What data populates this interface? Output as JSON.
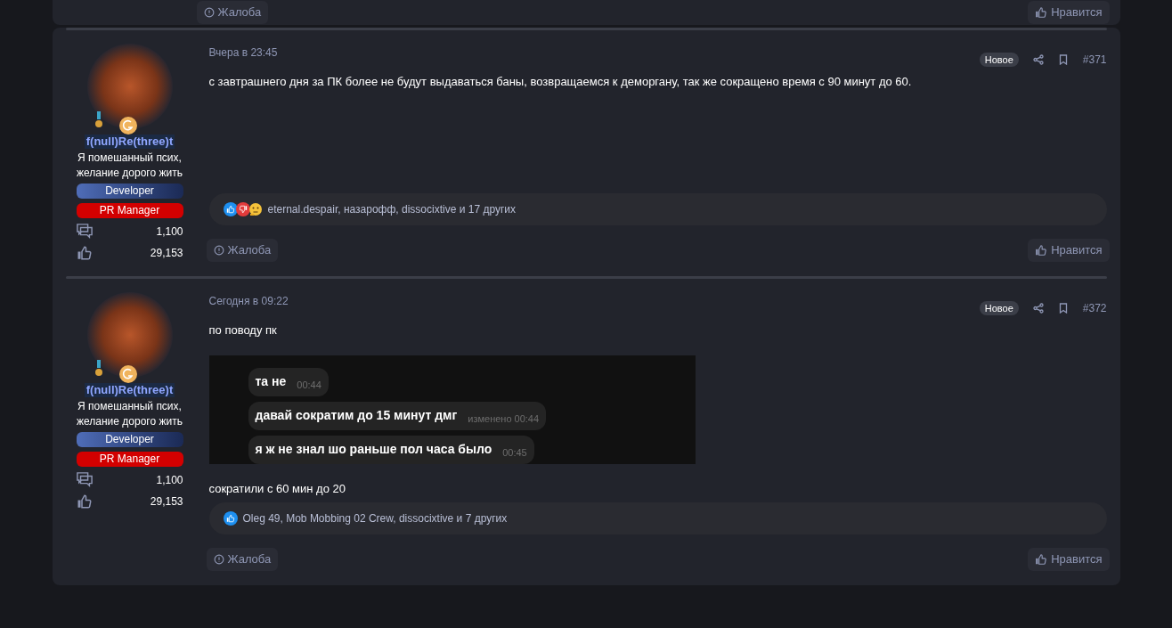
{
  "previous_post_footer": {
    "report": "Жалоба",
    "like": "Нравится"
  },
  "posts": [
    {
      "author": {
        "name": "f(null)Re(three)t",
        "status": "Я помешанный псих, желание дорого жить",
        "banners": [
          {
            "label": "Developer",
            "kind": "developer"
          },
          {
            "label": "PR Manager",
            "kind": "manager"
          }
        ],
        "stats": [
          {
            "kind": "messages",
            "value": "1,100"
          },
          {
            "kind": "likes",
            "value": "29,153"
          }
        ]
      },
      "date": "Вчера в 23:45",
      "new_label": "Новое",
      "number": "#371",
      "blocks": [
        {
          "kind": "text",
          "text": "с завтрашнего дня за ПК более не будут выдаваться баны, возвращаемся к деморгану, так же сокращено время с 90 минут до 60."
        }
      ],
      "reactions": {
        "icons": [
          {
            "kind": "like"
          },
          {
            "kind": "dislike"
          },
          {
            "kind": "thinking"
          }
        ],
        "text": "eternal.despair, назарофф, dissocixtive и 17 других"
      },
      "report": "Жалоба",
      "like": "Нравится"
    },
    {
      "author": {
        "name": "f(null)Re(three)t",
        "status": "Я помешанный псих, желание дорого жить",
        "banners": [
          {
            "label": "Developer",
            "kind": "developer"
          },
          {
            "label": "PR Manager",
            "kind": "manager"
          }
        ],
        "stats": [
          {
            "kind": "messages",
            "value": "1,100"
          },
          {
            "kind": "likes",
            "value": "29,153"
          }
        ]
      },
      "date": "Сегодня в 09:22",
      "new_label": "Новое",
      "number": "#372",
      "blocks": [
        {
          "kind": "text",
          "text": "по поводу пк"
        },
        {
          "kind": "chat",
          "messages": [
            {
              "text": "та не",
              "meta": "00:44"
            },
            {
              "text": "давай сократим до 15 минут дмг",
              "meta": "изменено 00:44"
            },
            {
              "text": "я ж не знал шо раньше пол часа было",
              "meta": "00:45"
            }
          ]
        },
        {
          "kind": "text",
          "text": "сократили с 60 мин до 20"
        }
      ],
      "reactions": {
        "icons": [
          {
            "kind": "like"
          }
        ],
        "text": "Oleg 49, Mob Mobbing 02 Crew, dissocixtive и 7 других"
      },
      "report": "Жалоба",
      "like": "Нравится"
    }
  ]
}
